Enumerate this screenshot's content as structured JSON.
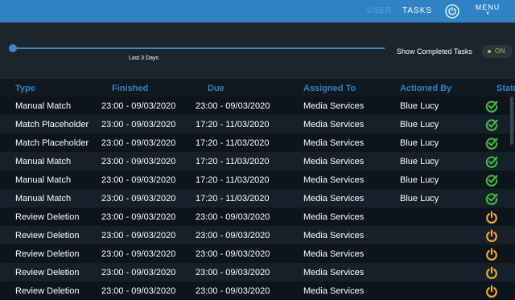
{
  "nav": {
    "user": "USER",
    "tasks": "TASKS",
    "menu": "MENU",
    "logout_icon": "power-icon",
    "menu_icon": "chevron-down-icon"
  },
  "filter": {
    "period_label": "Last 3 Days",
    "period_position": 0.0,
    "show_completed_label": "Show Completed Tasks",
    "show_completed_state": "ON"
  },
  "colors": {
    "accent": "#2f83c4",
    "complete": "#3fb83f",
    "pending": "#f0a92a",
    "toggle_on": "#8fd14f"
  },
  "table": {
    "headers": [
      "Type",
      "Finished",
      "Due",
      "Assigned To",
      "Actioned By",
      "Status"
    ],
    "rows": [
      {
        "type": "Manual Match",
        "finished": "23:00 - 09/03/2020",
        "due": "23:00 - 09/03/2020",
        "assigned": "Media Services",
        "actioned": "Blue Lucy",
        "status": "complete"
      },
      {
        "type": "Match Placeholder",
        "finished": "23:00 - 09/03/2020",
        "due": "17:20 - 11/03/2020",
        "assigned": "Media Services",
        "actioned": "Blue Lucy",
        "status": "complete"
      },
      {
        "type": "Match Placeholder",
        "finished": "23:00 - 09/03/2020",
        "due": "17:20 - 11/03/2020",
        "assigned": "Media Services",
        "actioned": "Blue Lucy",
        "status": "complete"
      },
      {
        "type": "Manual Match",
        "finished": "23:00 - 09/03/2020",
        "due": "17:20 - 11/03/2020",
        "assigned": "Media Services",
        "actioned": "Blue Lucy",
        "status": "complete"
      },
      {
        "type": "Manual Match",
        "finished": "23:00 - 09/03/2020",
        "due": "17:20 - 11/03/2020",
        "assigned": "Media Services",
        "actioned": "Blue Lucy",
        "status": "complete"
      },
      {
        "type": "Manual Match",
        "finished": "23:00 - 09/03/2020",
        "due": "17:20 - 11/03/2020",
        "assigned": "Media Services",
        "actioned": "Blue Lucy",
        "status": "complete"
      },
      {
        "type": "Review Deletion",
        "finished": "23:00 - 09/03/2020",
        "due": "23:00 - 09/03/2020",
        "assigned": "Media Services",
        "actioned": "",
        "status": "pending"
      },
      {
        "type": "Review Deletion",
        "finished": "23:00 - 09/03/2020",
        "due": "23:00 - 09/03/2020",
        "assigned": "Media Services",
        "actioned": "",
        "status": "pending"
      },
      {
        "type": "Review Deletion",
        "finished": "23:00 - 09/03/2020",
        "due": "23:00 - 09/03/2020",
        "assigned": "Media Services",
        "actioned": "",
        "status": "pending"
      },
      {
        "type": "Review Deletion",
        "finished": "23:00 - 09/03/2020",
        "due": "23:00 - 09/03/2020",
        "assigned": "Media Services",
        "actioned": "",
        "status": "pending"
      },
      {
        "type": "Review Deletion",
        "finished": "23:00 - 09/03/2020",
        "due": "23:00 - 09/03/2020",
        "assigned": "Media Services",
        "actioned": "",
        "status": "pending"
      }
    ]
  }
}
